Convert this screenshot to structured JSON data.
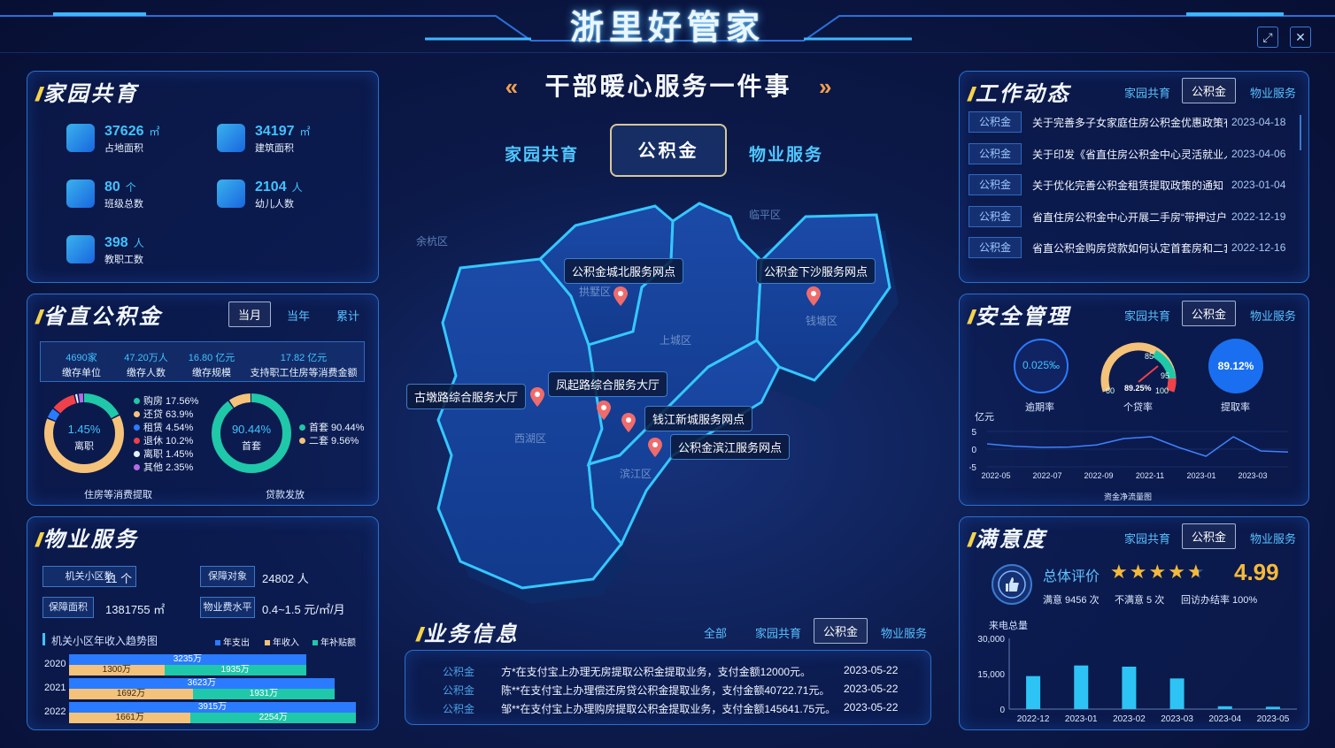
{
  "header": {
    "title": "浙里好管家"
  },
  "window_controls": {
    "expand": "⤢",
    "close": "✕"
  },
  "center": {
    "banner": "干部暖心服务一件事",
    "tabs": [
      "家园共育",
      "公积金",
      "物业服务"
    ],
    "active_tab": "公积金",
    "map_districts": [
      "余杭区",
      "临平区",
      "拱墅区",
      "钱塘区",
      "上城区",
      "西湖区",
      "滨江区"
    ],
    "service_points": [
      "公积金城北服务网点",
      "公积金下沙服务网点",
      "凤起路综合服务大厅",
      "古墩路综合服务大厅",
      "钱江新城服务网点",
      "公积金滨江服务网点"
    ]
  },
  "home_edu": {
    "title": "家园共育",
    "stats": [
      {
        "value": "37626",
        "unit": "㎡",
        "label": "占地面积",
        "icon": "land-area-icon"
      },
      {
        "value": "34197",
        "unit": "㎡",
        "label": "建筑面积",
        "icon": "building-icon"
      },
      {
        "value": "80",
        "unit": "个",
        "label": "班级总数",
        "icon": "class-icon"
      },
      {
        "value": "2104",
        "unit": "人",
        "label": "幼儿人数",
        "icon": "child-icon"
      },
      {
        "value": "398",
        "unit": "人",
        "label": "教职工数",
        "icon": "staff-icon"
      }
    ]
  },
  "fund": {
    "title": "省直公积金",
    "tabs": [
      "当月",
      "当年",
      "累计"
    ],
    "active_tab": "当月",
    "summary": [
      {
        "value": "4690家",
        "label": "缴存单位"
      },
      {
        "value": "47.20万人",
        "label": "缴存人数"
      },
      {
        "value": "16.80 亿元",
        "label": "缴存规模"
      },
      {
        "value": "17.82 亿元",
        "label": "支持职工住房等消费金额"
      }
    ],
    "donut1": {
      "center_value": "1.45%",
      "center_label": "离职",
      "caption": "住房等消费提取",
      "legend": [
        {
          "label": "购房 17.56%",
          "value": 17.56,
          "color": "#1fc8a8"
        },
        {
          "label": "还贷 63.9%",
          "value": 63.9,
          "color": "#f5c27a"
        },
        {
          "label": "租赁 4.54%",
          "value": 4.54,
          "color": "#2a7bff"
        },
        {
          "label": "退休 10.2%",
          "value": 10.2,
          "color": "#f0404a"
        },
        {
          "label": "离职 1.45%",
          "value": 1.45,
          "color": "#e8f2ff"
        },
        {
          "label": "其他 2.35%",
          "value": 2.35,
          "color": "#b46be8"
        }
      ]
    },
    "donut2": {
      "center_value": "90.44%",
      "center_label": "首套",
      "caption": "贷款发放",
      "legend": [
        {
          "label": "首套 90.44%",
          "value": 90.44,
          "color": "#1fc8a8"
        },
        {
          "label": "二套 9.56%",
          "value": 9.56,
          "color": "#f5c27a"
        }
      ]
    }
  },
  "property": {
    "title": "物业服务",
    "kv": [
      {
        "key": "机关小区数",
        "value": "11 个"
      },
      {
        "key": "保障对象",
        "value": "24802 人"
      },
      {
        "key": "保障面积",
        "value": "1381755 ㎡"
      },
      {
        "key": "物业费水平",
        "value": "0.4~1.5 元/㎡/月"
      }
    ],
    "trend_title": "机关小区年收入趋势图",
    "legend": [
      "年支出",
      "年收入",
      "年补贴额"
    ],
    "rows": [
      {
        "year": "2020",
        "expense": "3235万",
        "income": "1300万",
        "subsidy": "1935万",
        "expense_v": 3235,
        "income_v": 1300,
        "subsidy_v": 1935
      },
      {
        "year": "2021",
        "expense": "3623万",
        "income": "1692万",
        "subsidy": "1931万",
        "expense_v": 3623,
        "income_v": 1692,
        "subsidy_v": 1931
      },
      {
        "year": "2022",
        "expense": "3915万",
        "income": "1661万",
        "subsidy": "2254万",
        "expense_v": 3915,
        "income_v": 1661,
        "subsidy_v": 2254
      }
    ]
  },
  "work": {
    "title": "工作动态",
    "tabs": [
      "家园共育",
      "公积金",
      "物业服务"
    ],
    "active_tab": "公积金",
    "items": [
      {
        "tag": "公积金",
        "text": "关于完善多子女家庭住房公积金优惠政策有...",
        "date": "2023-04-18"
      },
      {
        "tag": "公积金",
        "text": "关于印发《省直住房公积金中心灵活就业人...",
        "date": "2023-04-06"
      },
      {
        "tag": "公积金",
        "text": "关于优化完善公积金租赁提取政策的通知",
        "date": "2023-01-04"
      },
      {
        "tag": "公积金",
        "text": "省直住房公积金中心开展二手房“带押过户...",
        "date": "2022-12-19"
      },
      {
        "tag": "公积金",
        "text": "省直公积金购房贷款如何认定首套房和二套房",
        "date": "2022-12-16"
      }
    ]
  },
  "safety": {
    "title": "安全管理",
    "tabs": [
      "家园共育",
      "公积金",
      "物业服务"
    ],
    "active_tab": "公积金",
    "gauges": [
      {
        "value": "0.025‰",
        "label": "逾期率"
      },
      {
        "value": "89.25%",
        "label": "个贷率",
        "ticks": [
          "60",
          "85",
          "95",
          "100"
        ]
      },
      {
        "value": "89.12%",
        "label": "提取率"
      }
    ],
    "line": {
      "unit": "亿元",
      "caption": "资金净流量图",
      "yticks": [
        "5",
        "0",
        "-5"
      ],
      "xticks": [
        "2022-05",
        "2022-07",
        "2022-09",
        "2022-11",
        "2023-01",
        "2023-03"
      ]
    }
  },
  "satisfaction": {
    "title": "满意度",
    "tabs": [
      "家园共育",
      "公积金",
      "物业服务"
    ],
    "active_tab": "公积金",
    "overall_label": "总体评价",
    "score": "4.99",
    "stars": 4.99,
    "stats": [
      "满意 9456 次",
      "不满意 5 次",
      "回访办结率 100%"
    ]
  },
  "business": {
    "title": "业务信息",
    "tabs": [
      "全部",
      "家园共育",
      "公积金",
      "物业服务"
    ],
    "active_tab": "公积金",
    "rows": [
      {
        "tag": "公积金",
        "text": "方*在支付宝上办理无房提取公积金提取业务，支付金额12000元。",
        "date": "2023-05-22"
      },
      {
        "tag": "公积金",
        "text": "陈**在支付宝上办理偿还房贷公积金提取业务，支付金额40722.71元。",
        "date": "2023-05-22"
      },
      {
        "tag": "公积金",
        "text": "邹**在支付宝上办理购房提取公积金提取业务，支付金额145641.75元。",
        "date": "2023-05-22"
      }
    ]
  },
  "chart_data": [
    {
      "type": "line",
      "title": "资金净流量图",
      "ylabel": "亿元",
      "x": [
        "2022-05",
        "2022-06",
        "2022-07",
        "2022-08",
        "2022-09",
        "2022-10",
        "2022-11",
        "2022-12",
        "2023-01",
        "2023-02",
        "2023-03",
        "2023-04"
      ],
      "series": [
        {
          "values": [
            1.5,
            0.8,
            0.5,
            0.6,
            1.2,
            3.0,
            3.5,
            0.5,
            -2.0,
            3.5,
            -0.5,
            -0.8
          ]
        }
      ],
      "ylim": [
        -5,
        5
      ]
    },
    {
      "type": "bar",
      "ylabel": "来电总量",
      "categories": [
        "2022-12",
        "2023-01",
        "2023-02",
        "2023-03",
        "2023-04",
        "2023-05"
      ],
      "values": [
        14000,
        18500,
        18000,
        13000,
        1200,
        1000
      ],
      "ylim": [
        0,
        30000
      ],
      "yticks": [
        "30,000",
        "15,000",
        "0"
      ]
    }
  ],
  "colors": {
    "accent": "#3fc3ff",
    "gold": "#f5d34a",
    "border": "#2a6fc9"
  }
}
